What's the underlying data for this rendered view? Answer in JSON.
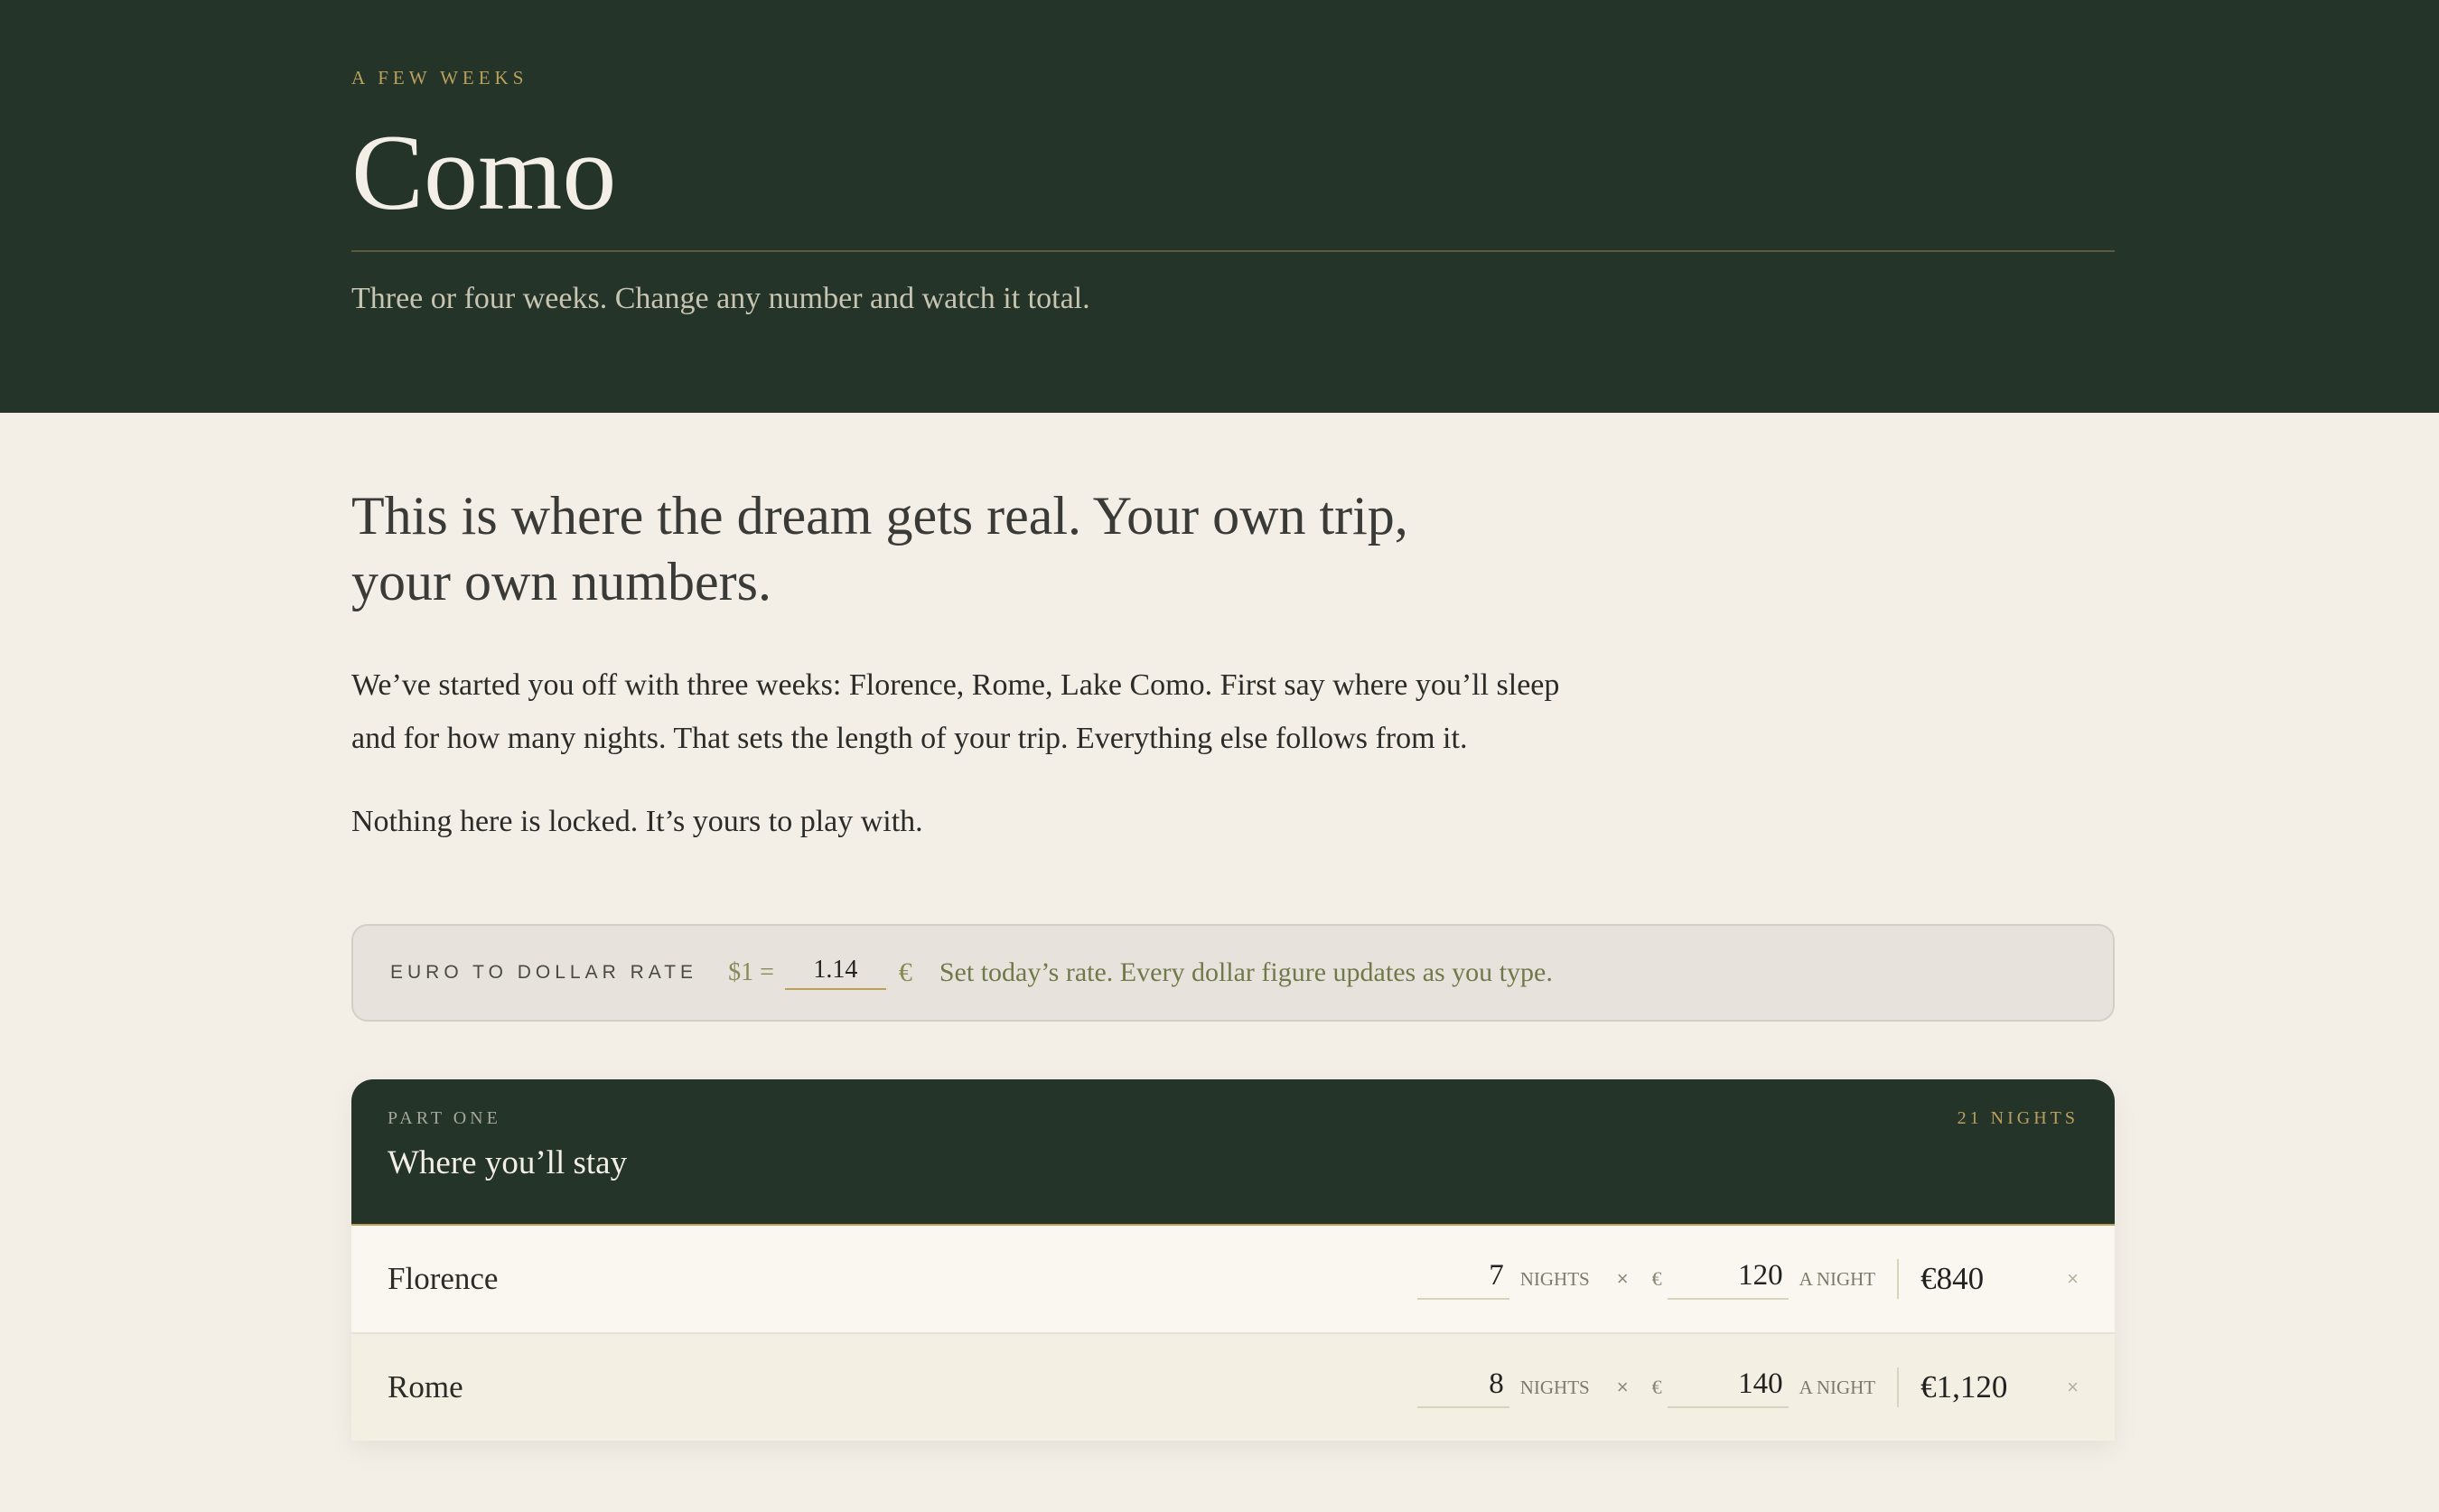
{
  "header": {
    "eyebrow": "A FEW WEEKS",
    "title": "Como",
    "subtitle": "Three or four weeks. Change any number and watch it total."
  },
  "intro": {
    "lead": "This is where the dream gets real. Your own trip, your own numbers.",
    "paragraph1": "We’ve started you off with three weeks: Florence, Rome, Lake Como. First say where you’ll sleep and for how many nights. That sets the length of your trip. Everything else follows from it.",
    "paragraph2": "Nothing here is locked. It’s yours to play with."
  },
  "rate": {
    "label": "EURO TO DOLLAR RATE",
    "prefix": "$1 =",
    "value": "1.14",
    "currency": "€",
    "hint": "Set today’s rate. Every dollar figure updates as you type."
  },
  "stays": {
    "part": "PART ONE",
    "title": "Where you’ll stay",
    "nights_total": "21 NIGHTS",
    "nights_unit": "NIGHTS",
    "times": "×",
    "currency": "€",
    "per_night": "A NIGHT",
    "remove": "×",
    "rows": [
      {
        "city": "Florence",
        "nights": "7",
        "price": "120",
        "total": "€840"
      },
      {
        "city": "Rome",
        "nights": "8",
        "price": "140",
        "total": "€1,120"
      }
    ]
  },
  "colors": {
    "dark_green": "#253428",
    "gold": "#b9a15b",
    "cream": "#f3efe7"
  }
}
